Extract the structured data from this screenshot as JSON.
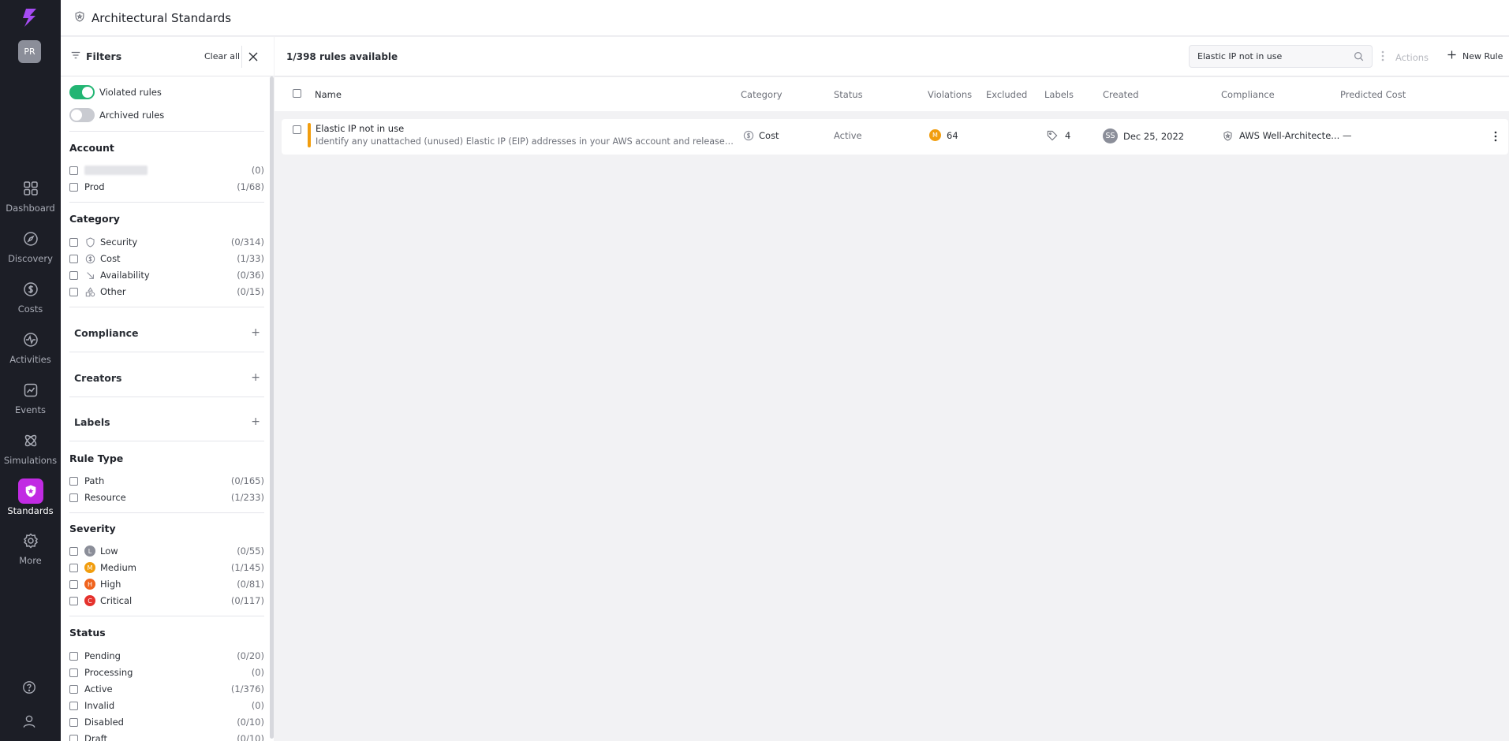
{
  "app": {
    "user_initials": "PR",
    "nav": [
      {
        "label": "Dashboard",
        "icon": "dashboard-icon"
      },
      {
        "label": "Discovery",
        "icon": "compass-icon"
      },
      {
        "label": "Costs",
        "icon": "dollar-icon"
      },
      {
        "label": "Activities",
        "icon": "activity-icon"
      },
      {
        "label": "Events",
        "icon": "chart-icon"
      },
      {
        "label": "Simulations",
        "icon": "atom-icon"
      },
      {
        "label": "Standards",
        "icon": "shield-star-icon",
        "active": true
      },
      {
        "label": "More",
        "icon": "gear-icon"
      }
    ],
    "accent_color": "#c12be3"
  },
  "header": {
    "title": "Architectural Standards"
  },
  "filters": {
    "title": "Filters",
    "clear_label": "Clear all",
    "toggles": [
      {
        "label": "Violated rules",
        "on": true
      },
      {
        "label": "Archived rules",
        "on": false
      }
    ],
    "account": {
      "title": "Account",
      "items": [
        {
          "label": "",
          "count": "(0)"
        },
        {
          "label": "Prod",
          "count": "(1/68)"
        }
      ]
    },
    "category": {
      "title": "Category",
      "items": [
        {
          "label": "Security",
          "count": "(0/314)"
        },
        {
          "label": "Cost",
          "count": "(1/33)"
        },
        {
          "label": "Availability",
          "count": "(0/36)"
        },
        {
          "label": "Other",
          "count": "(0/15)"
        }
      ]
    },
    "compliance": {
      "title": "Compliance"
    },
    "creators": {
      "title": "Creators"
    },
    "labels": {
      "title": "Labels"
    },
    "rule_type": {
      "title": "Rule Type",
      "items": [
        {
          "label": "Path",
          "count": "(0/165)"
        },
        {
          "label": "Resource",
          "count": "(1/233)"
        }
      ]
    },
    "severity": {
      "title": "Severity",
      "items": [
        {
          "label": "Low",
          "count": "(0/55)",
          "badge": "L",
          "color": "#8b8e99"
        },
        {
          "label": "Medium",
          "count": "(1/145)",
          "badge": "M",
          "color": "#f19d0e"
        },
        {
          "label": "High",
          "count": "(0/81)",
          "badge": "H",
          "color": "#f0641e"
        },
        {
          "label": "Critical",
          "count": "(0/117)",
          "badge": "C",
          "color": "#e5322d"
        }
      ]
    },
    "status": {
      "title": "Status",
      "items": [
        {
          "label": "Pending",
          "count": "(0/20)"
        },
        {
          "label": "Processing",
          "count": "(0)"
        },
        {
          "label": "Active",
          "count": "(1/376)"
        },
        {
          "label": "Invalid",
          "count": "(0)"
        },
        {
          "label": "Disabled",
          "count": "(0/10)"
        },
        {
          "label": "Draft",
          "count": "(0/10)"
        }
      ]
    }
  },
  "main": {
    "available": "1/398 rules available",
    "search": {
      "value": "Elastic IP not in use"
    },
    "actions_label": "Actions",
    "new_rule_label": "New Rule",
    "columns": [
      "Name",
      "Category",
      "Status",
      "Violations",
      "Excluded",
      "Labels",
      "Created",
      "Compliance",
      "Predicted Cost"
    ],
    "rows": [
      {
        "name": "Elastic IP not in use",
        "description": "Identify any unattached (unused) Elastic IP (EIP) addresses in your AWS account and release (remove) them in order to lower the cost",
        "category": "Cost",
        "status": "Active",
        "severity_badge": "M",
        "violations": "64",
        "labels": "4",
        "creator_initials": "SS",
        "created": "Dec 25, 2022",
        "compliance": "AWS Well-Architecte...",
        "predicted_cost": "—"
      }
    ]
  }
}
